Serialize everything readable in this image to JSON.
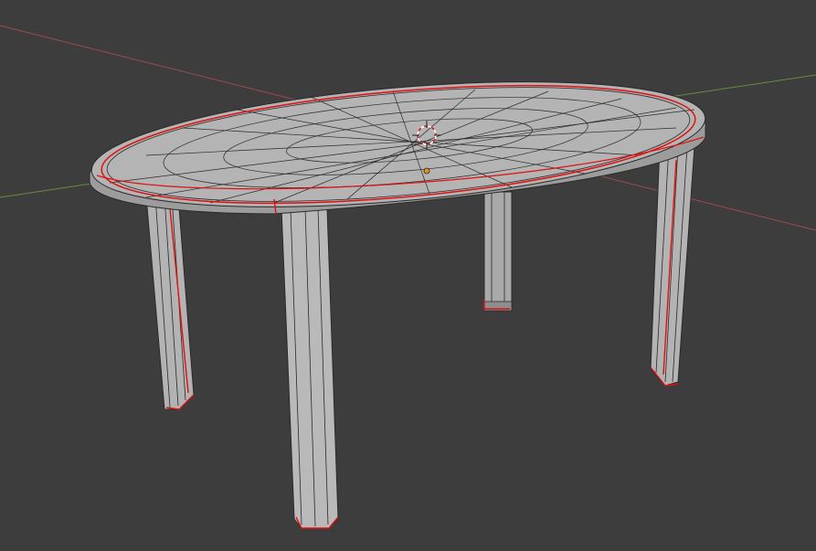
{
  "viewport": {
    "mode": "edit-mode-wireframe-overlay",
    "background": "#3d3d3d",
    "axis_x_color": "#9c4a52",
    "axis_y_color": "#6a8b3a",
    "mesh_color": "#b8b8b8",
    "wire_color": "#2a2a2a",
    "seam_color": "#e01010",
    "origin_color": "#e8901a",
    "cursor_icon": "3d-cursor-icon",
    "origin_icon": "object-origin-icon"
  },
  "object": {
    "name": "",
    "type": "table-mesh",
    "legs": 4,
    "top_shape": "oval"
  }
}
